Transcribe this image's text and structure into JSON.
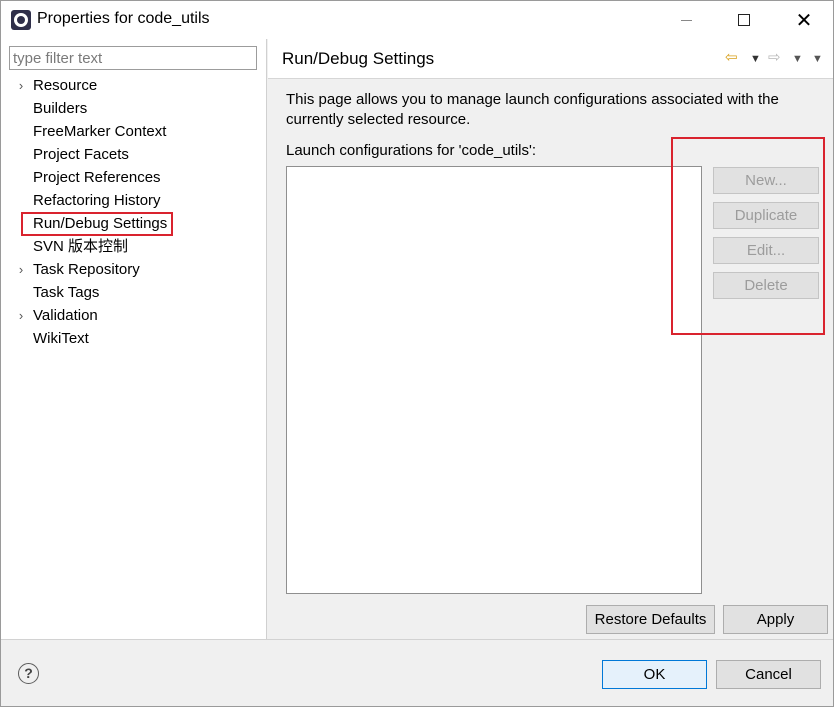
{
  "window": {
    "title": "Properties for code_utils",
    "minimize_label": "",
    "maximize_label": "",
    "close_label": "✕"
  },
  "filter": {
    "placeholder": "type filter text",
    "value": ""
  },
  "tree": {
    "items": [
      {
        "label": "Resource",
        "expandable": true,
        "selected": false
      },
      {
        "label": "Builders",
        "expandable": false,
        "selected": false
      },
      {
        "label": "FreeMarker Context",
        "expandable": false,
        "selected": false
      },
      {
        "label": "Project Facets",
        "expandable": false,
        "selected": false
      },
      {
        "label": "Project References",
        "expandable": false,
        "selected": false
      },
      {
        "label": "Refactoring History",
        "expandable": false,
        "selected": false
      },
      {
        "label": "Run/Debug Settings",
        "expandable": false,
        "selected": true
      },
      {
        "label": "SVN 版本控制",
        "expandable": false,
        "selected": false
      },
      {
        "label": "Task Repository",
        "expandable": true,
        "selected": false
      },
      {
        "label": "Task Tags",
        "expandable": false,
        "selected": false
      },
      {
        "label": "Validation",
        "expandable": true,
        "selected": false
      },
      {
        "label": "WikiText",
        "expandable": false,
        "selected": false
      }
    ],
    "arrow_glyph": "›"
  },
  "page": {
    "title": "Run/Debug Settings",
    "nav": {
      "back_glyph": "⇦",
      "forward_glyph": "⇨",
      "dropdown_glyph": "▼",
      "menu_glyph": "▼"
    },
    "description_line1": "This page allows you to manage launch configurations associated with the",
    "description_line2": "currently selected resource.",
    "list_label": "Launch configurations for 'code_utils':",
    "buttons": {
      "new": "New...",
      "duplicate": "Duplicate",
      "edit": "Edit...",
      "delete": "Delete"
    },
    "restore_defaults": "Restore Defaults",
    "apply": "Apply"
  },
  "footer": {
    "help_glyph": "?",
    "ok": "OK",
    "cancel": "Cancel"
  },
  "colors": {
    "highlight": "#d9232e",
    "ok_border": "#0078d7",
    "disabled_text": "#9c9c9c"
  }
}
